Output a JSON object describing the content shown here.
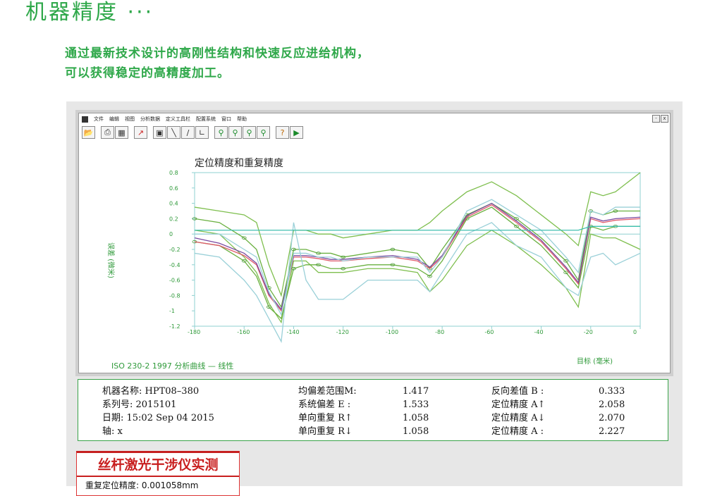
{
  "page": {
    "title": "机器精度 ···",
    "intro_lines": [
      "通过最新技术设计的高刚性结构和快速反应进给机构，",
      "可以获得稳定的高精度加工。"
    ]
  },
  "app": {
    "menu": [
      "文件",
      "编辑",
      "视图",
      "分析数据",
      "定义工具栏",
      "配置系统",
      "窗口",
      "帮助"
    ],
    "window_controls": [
      "-",
      "x"
    ],
    "toolbar_icons": [
      "open-icon",
      "print-icon",
      "print-preview-icon",
      "line-chart-icon",
      "window-icon",
      "pen-icon",
      "scale-icon",
      "axes-icon",
      "zoom-in-icon",
      "zoom-out-icon",
      "zoom-fit-icon",
      "zoom-reset-icon",
      "help-icon",
      "exit-icon"
    ]
  },
  "colors": {
    "accent_green": "#2fa84a",
    "banner_red": "#c81e1e",
    "grid_blue": "#80c8c8"
  },
  "chart_data": {
    "type": "line",
    "title": "定位精度和重复精度",
    "ylabel": "误差 (微米)",
    "xlabel": "目标 (毫米)",
    "footer": "ISO 230-2 1997  分析曲线 — 线性",
    "xlim": [
      -180,
      0
    ],
    "ylim": [
      -1.2,
      0.8
    ],
    "x_ticks": [
      "-180",
      "-160",
      "-140",
      "-120",
      "-100",
      "-80",
      "-60",
      "-40",
      "-20",
      "0"
    ],
    "y_ticks": [
      "0.8",
      "0.6",
      "0.4",
      "0.2",
      "0",
      "-0.2",
      "-0.4",
      "-0.6",
      "-0.8",
      "-1",
      "-1.2"
    ],
    "x": [
      -180,
      -170,
      -160,
      -155,
      -150,
      -145,
      -140,
      -135,
      -130,
      -125,
      -120,
      -110,
      -100,
      -90,
      -85,
      -80,
      -70,
      -60,
      -50,
      -40,
      -30,
      -25,
      -20,
      -15,
      -10,
      0
    ],
    "series": [
      {
        "color": "#7fbf4f",
        "values": [
          0.35,
          0.3,
          0.25,
          0.15,
          -0.4,
          -0.8,
          0.05,
          0.05,
          0.0,
          0.0,
          -0.05,
          0.0,
          0.05,
          0.05,
          0.15,
          0.3,
          0.55,
          0.68,
          0.5,
          0.25,
          0.0,
          -0.15,
          0.55,
          0.5,
          0.55,
          0.8
        ]
      },
      {
        "color": "#7fbf4f",
        "values": [
          0.05,
          0.0,
          -0.3,
          -0.5,
          -0.9,
          -1.15,
          -0.35,
          -0.35,
          -0.5,
          -0.5,
          -0.5,
          -0.45,
          -0.45,
          -0.5,
          -0.75,
          -0.6,
          -0.15,
          0.05,
          -0.15,
          -0.4,
          -0.7,
          -0.95,
          0.0,
          -0.05,
          -0.05,
          -0.2
        ]
      },
      {
        "color": "#6ab040",
        "values": [
          0.2,
          0.15,
          -0.05,
          -0.2,
          -0.7,
          -0.95,
          -0.2,
          -0.2,
          -0.25,
          -0.25,
          -0.3,
          -0.25,
          -0.2,
          -0.25,
          -0.45,
          -0.2,
          0.25,
          0.4,
          0.2,
          -0.05,
          -0.35,
          -0.6,
          0.3,
          0.25,
          0.3,
          0.3
        ]
      },
      {
        "color": "#6ab040",
        "values": [
          -0.1,
          -0.15,
          -0.35,
          -0.55,
          -0.95,
          -1.1,
          -0.45,
          -0.4,
          -0.4,
          -0.45,
          -0.45,
          -0.4,
          -0.4,
          -0.45,
          -0.55,
          -0.35,
          0.2,
          0.35,
          0.1,
          -0.15,
          -0.5,
          -0.7,
          0.1,
          0.05,
          0.1,
          0.1
        ]
      },
      {
        "color": "#e05a6a",
        "values": [
          -0.1,
          -0.15,
          -0.28,
          -0.4,
          -0.8,
          -1.0,
          -0.3,
          -0.3,
          -0.32,
          -0.35,
          -0.35,
          -0.32,
          -0.3,
          -0.35,
          -0.45,
          -0.3,
          0.22,
          0.38,
          0.15,
          -0.1,
          -0.45,
          -0.65,
          0.2,
          0.15,
          0.18,
          0.2
        ]
      },
      {
        "color": "#7a4aa0",
        "values": [
          -0.05,
          -0.12,
          -0.25,
          -0.38,
          -0.78,
          -0.98,
          -0.28,
          -0.28,
          -0.3,
          -0.33,
          -0.33,
          -0.3,
          -0.28,
          -0.33,
          -0.43,
          -0.28,
          0.24,
          0.4,
          0.17,
          -0.08,
          -0.43,
          -0.63,
          0.22,
          0.17,
          0.2,
          0.22
        ]
      },
      {
        "color": "#9ad0d8",
        "values": [
          -0.25,
          -0.3,
          -0.6,
          -0.8,
          -1.1,
          -1.4,
          0.15,
          -0.6,
          -0.85,
          -0.85,
          -0.85,
          -0.6,
          -0.6,
          -0.6,
          -0.75,
          -0.5,
          0.0,
          0.15,
          -0.15,
          -0.3,
          -0.7,
          -0.8,
          -0.3,
          -0.25,
          -0.4,
          -0.25
        ]
      },
      {
        "color": "#9ad0d8",
        "values": [
          0.0,
          0.0,
          -0.2,
          -0.3,
          -0.75,
          -1.05,
          -0.25,
          -0.25,
          -0.3,
          -0.3,
          -0.35,
          -0.3,
          -0.3,
          -0.3,
          -0.5,
          -0.3,
          0.3,
          0.45,
          0.25,
          0.05,
          -0.3,
          -0.5,
          0.3,
          0.25,
          0.35,
          0.35
        ]
      },
      {
        "color": "#40c0b0",
        "values": [
          0.05,
          0.05,
          0.05,
          0.05,
          0.05,
          0.05,
          0.05,
          0.05,
          0.05,
          0.05,
          0.05,
          0.05,
          0.05,
          0.05,
          0.05,
          0.05,
          0.05,
          0.05,
          0.05,
          0.05,
          0.05,
          0.05,
          0.1,
          0.1,
          0.1,
          0.1
        ]
      }
    ]
  },
  "stats": {
    "col1": [
      "机器名称: HPT08–380",
      "系列号: 2015101",
      "日期: 15:02  Sep 04 2015",
      "轴: x"
    ],
    "col2_labels": [
      "均偏差范围M:",
      "系统偏差 E  :",
      "单向重复 R↑",
      "单向重复 R↓"
    ],
    "col2_values": [
      "1.417",
      "1.533",
      "1.058",
      "1.058"
    ],
    "col3_labels": [
      "反向差值 B :",
      "定位精度 A↑",
      "定位精度 A↓",
      "定位精度 A :"
    ],
    "col3_values": [
      "0.333",
      "2.058",
      "2.070",
      "2.227"
    ]
  },
  "banner": {
    "title": "丝杆激光干涉仪实测",
    "subtitle": "重复定位精度: 0.001058mm"
  }
}
